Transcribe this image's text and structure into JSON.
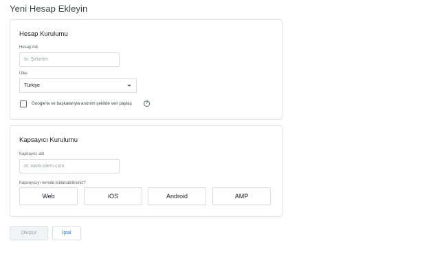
{
  "page_title": "Yeni Hesap Ekleyin",
  "account_setup": {
    "title": "Hesap Kurulumu",
    "account_name_label": "Hesap Adı",
    "account_name_placeholder": "ör. Şirketim",
    "country_label": "Ülke",
    "country_value": "Türkiye",
    "share_checkbox_label": "Google'la ve başkalarıyla anonim şekilde veri paylaş",
    "share_checked": false
  },
  "container_setup": {
    "title": "Kapsayıcı Kurulumu",
    "container_name_label": "Kapsayıcı adı",
    "container_name_placeholder": "ör. www.sitem.com",
    "platform_question": "Kapsayıcıyı nerede kullanabilirsiniz?",
    "platforms": [
      "Web",
      "iOS",
      "Android",
      "AMP"
    ]
  },
  "actions": {
    "create_label": "Oluştur",
    "cancel_label": "İptal"
  },
  "help_glyph": "?",
  "colors": {
    "link_blue": "#1a73e8",
    "border": "#dadce0",
    "disabled_text": "#9aa0a6"
  }
}
